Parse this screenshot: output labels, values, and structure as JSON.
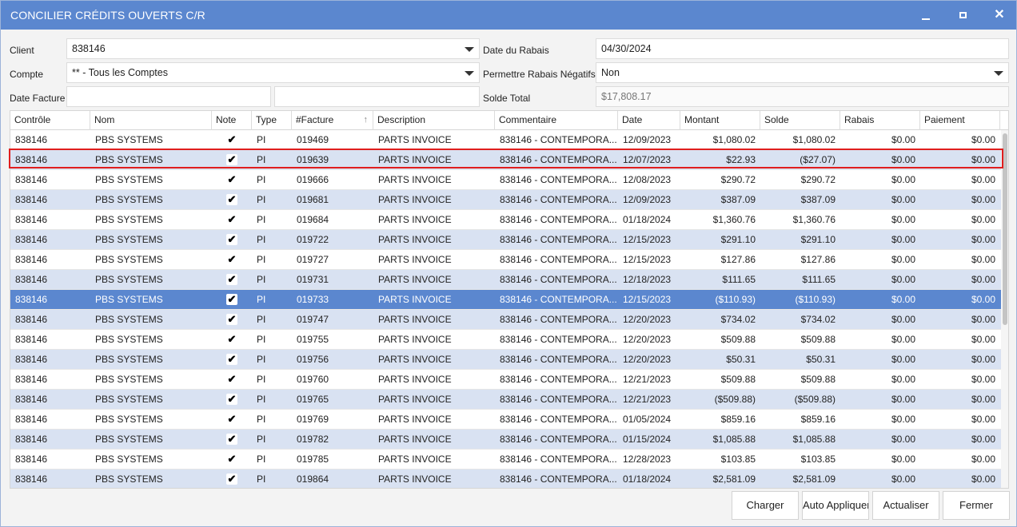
{
  "window": {
    "title": "CONCILIER CRÉDITS OUVERTS C/R",
    "min_icon": "minimize-icon",
    "max_icon": "maximize-icon",
    "close_icon": "close-icon",
    "close_glyph": "✕"
  },
  "form": {
    "client_label": "Client",
    "client_value": "838146",
    "compte_label": "Compte",
    "compte_value": "** - Tous les Comptes",
    "date_facture_label": "Date Facture",
    "date_facture_value": "",
    "date_facture_value2": "",
    "date_rabais_label": "Date du Rabais",
    "date_rabais_value": "04/30/2024",
    "permettre_label": "Permettre Rabais Négatifs",
    "permettre_value": "Non",
    "solde_total_label": "Solde Total",
    "solde_total_value": "$17,808.17"
  },
  "grid": {
    "columns": [
      "Contrôle",
      "Nom",
      "Note",
      "Type",
      "#Facture",
      "Description",
      "Commentaire",
      "Date",
      "Montant",
      "Solde",
      "Rabais",
      "Paiement"
    ],
    "sort_indicator": "↑",
    "check_glyph": "✔",
    "selected_row_index": 8,
    "highlighted_row_index": 1,
    "rows": [
      [
        "838146",
        "PBS SYSTEMS",
        true,
        "PI",
        "019469",
        "PARTS INVOICE",
        "838146 - CONTEMPORA...",
        "12/09/2023",
        "$1,080.02",
        "$1,080.02",
        "$0.00",
        "$0.00"
      ],
      [
        "838146",
        "PBS SYSTEMS",
        true,
        "PI",
        "019639",
        "PARTS INVOICE",
        "838146 - CONTEMPORA...",
        "12/07/2023",
        "$22.93",
        "($27.07)",
        "$0.00",
        "$0.00"
      ],
      [
        "838146",
        "PBS SYSTEMS",
        true,
        "PI",
        "019666",
        "PARTS INVOICE",
        "838146 - CONTEMPORA...",
        "12/08/2023",
        "$290.72",
        "$290.72",
        "$0.00",
        "$0.00"
      ],
      [
        "838146",
        "PBS SYSTEMS",
        true,
        "PI",
        "019681",
        "PARTS INVOICE",
        "838146 - CONTEMPORA...",
        "12/09/2023",
        "$387.09",
        "$387.09",
        "$0.00",
        "$0.00"
      ],
      [
        "838146",
        "PBS SYSTEMS",
        true,
        "PI",
        "019684",
        "PARTS INVOICE",
        "838146 - CONTEMPORA...",
        "01/18/2024",
        "$1,360.76",
        "$1,360.76",
        "$0.00",
        "$0.00"
      ],
      [
        "838146",
        "PBS SYSTEMS",
        true,
        "PI",
        "019722",
        "PARTS INVOICE",
        "838146 - CONTEMPORA...",
        "12/15/2023",
        "$291.10",
        "$291.10",
        "$0.00",
        "$0.00"
      ],
      [
        "838146",
        "PBS SYSTEMS",
        true,
        "PI",
        "019727",
        "PARTS INVOICE",
        "838146 - CONTEMPORA...",
        "12/15/2023",
        "$127.86",
        "$127.86",
        "$0.00",
        "$0.00"
      ],
      [
        "838146",
        "PBS SYSTEMS",
        true,
        "PI",
        "019731",
        "PARTS INVOICE",
        "838146 - CONTEMPORA...",
        "12/18/2023",
        "$111.65",
        "$111.65",
        "$0.00",
        "$0.00"
      ],
      [
        "838146",
        "PBS SYSTEMS",
        true,
        "PI",
        "019733",
        "PARTS INVOICE",
        "838146 - CONTEMPORA...",
        "12/15/2023",
        "($110.93)",
        "($110.93)",
        "$0.00",
        "$0.00"
      ],
      [
        "838146",
        "PBS SYSTEMS",
        true,
        "PI",
        "019747",
        "PARTS INVOICE",
        "838146 - CONTEMPORA...",
        "12/20/2023",
        "$734.02",
        "$734.02",
        "$0.00",
        "$0.00"
      ],
      [
        "838146",
        "PBS SYSTEMS",
        true,
        "PI",
        "019755",
        "PARTS INVOICE",
        "838146 - CONTEMPORA...",
        "12/20/2023",
        "$509.88",
        "$509.88",
        "$0.00",
        "$0.00"
      ],
      [
        "838146",
        "PBS SYSTEMS",
        true,
        "PI",
        "019756",
        "PARTS INVOICE",
        "838146 - CONTEMPORA...",
        "12/20/2023",
        "$50.31",
        "$50.31",
        "$0.00",
        "$0.00"
      ],
      [
        "838146",
        "PBS SYSTEMS",
        true,
        "PI",
        "019760",
        "PARTS INVOICE",
        "838146 - CONTEMPORA...",
        "12/21/2023",
        "$509.88",
        "$509.88",
        "$0.00",
        "$0.00"
      ],
      [
        "838146",
        "PBS SYSTEMS",
        true,
        "PI",
        "019765",
        "PARTS INVOICE",
        "838146 - CONTEMPORA...",
        "12/21/2023",
        "($509.88)",
        "($509.88)",
        "$0.00",
        "$0.00"
      ],
      [
        "838146",
        "PBS SYSTEMS",
        true,
        "PI",
        "019769",
        "PARTS INVOICE",
        "838146 - CONTEMPORA...",
        "01/05/2024",
        "$859.16",
        "$859.16",
        "$0.00",
        "$0.00"
      ],
      [
        "838146",
        "PBS SYSTEMS",
        true,
        "PI",
        "019782",
        "PARTS INVOICE",
        "838146 - CONTEMPORA...",
        "01/15/2024",
        "$1,085.88",
        "$1,085.88",
        "$0.00",
        "$0.00"
      ],
      [
        "838146",
        "PBS SYSTEMS",
        true,
        "PI",
        "019785",
        "PARTS INVOICE",
        "838146 - CONTEMPORA...",
        "12/28/2023",
        "$103.85",
        "$103.85",
        "$0.00",
        "$0.00"
      ],
      [
        "838146",
        "PBS SYSTEMS",
        true,
        "PI",
        "019864",
        "PARTS INVOICE",
        "838146 - CONTEMPORA...",
        "01/18/2024",
        "$2,581.09",
        "$2,581.09",
        "$0.00",
        "$0.00"
      ]
    ]
  },
  "buttons": {
    "charger": "Charger",
    "auto_appliquer": "Auto Appliquer",
    "actualiser": "Actualiser",
    "fermer": "Fermer"
  },
  "colors": {
    "titlebar": "#5b87cf",
    "selected_row": "#5b87cf",
    "alt_row": "#d9e2f2",
    "highlight_border": "#e01e1e"
  }
}
